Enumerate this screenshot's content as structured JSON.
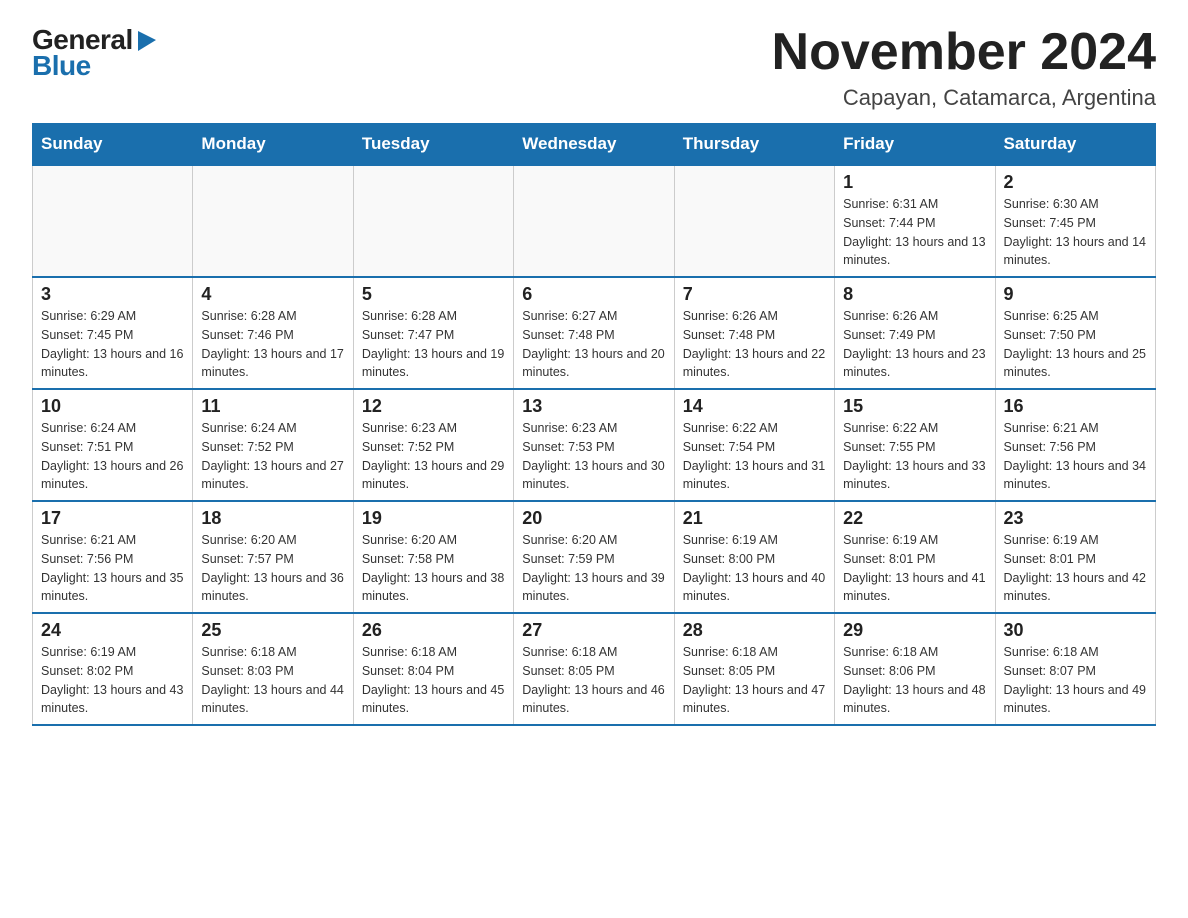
{
  "logo": {
    "general": "General",
    "blue": "Blue",
    "triangle": "▶"
  },
  "title": "November 2024",
  "location": "Capayan, Catamarca, Argentina",
  "days_of_week": [
    "Sunday",
    "Monday",
    "Tuesday",
    "Wednesday",
    "Thursday",
    "Friday",
    "Saturday"
  ],
  "weeks": [
    [
      {
        "day": "",
        "info": ""
      },
      {
        "day": "",
        "info": ""
      },
      {
        "day": "",
        "info": ""
      },
      {
        "day": "",
        "info": ""
      },
      {
        "day": "",
        "info": ""
      },
      {
        "day": "1",
        "info": "Sunrise: 6:31 AM\nSunset: 7:44 PM\nDaylight: 13 hours and 13 minutes."
      },
      {
        "day": "2",
        "info": "Sunrise: 6:30 AM\nSunset: 7:45 PM\nDaylight: 13 hours and 14 minutes."
      }
    ],
    [
      {
        "day": "3",
        "info": "Sunrise: 6:29 AM\nSunset: 7:45 PM\nDaylight: 13 hours and 16 minutes."
      },
      {
        "day": "4",
        "info": "Sunrise: 6:28 AM\nSunset: 7:46 PM\nDaylight: 13 hours and 17 minutes."
      },
      {
        "day": "5",
        "info": "Sunrise: 6:28 AM\nSunset: 7:47 PM\nDaylight: 13 hours and 19 minutes."
      },
      {
        "day": "6",
        "info": "Sunrise: 6:27 AM\nSunset: 7:48 PM\nDaylight: 13 hours and 20 minutes."
      },
      {
        "day": "7",
        "info": "Sunrise: 6:26 AM\nSunset: 7:48 PM\nDaylight: 13 hours and 22 minutes."
      },
      {
        "day": "8",
        "info": "Sunrise: 6:26 AM\nSunset: 7:49 PM\nDaylight: 13 hours and 23 minutes."
      },
      {
        "day": "9",
        "info": "Sunrise: 6:25 AM\nSunset: 7:50 PM\nDaylight: 13 hours and 25 minutes."
      }
    ],
    [
      {
        "day": "10",
        "info": "Sunrise: 6:24 AM\nSunset: 7:51 PM\nDaylight: 13 hours and 26 minutes."
      },
      {
        "day": "11",
        "info": "Sunrise: 6:24 AM\nSunset: 7:52 PM\nDaylight: 13 hours and 27 minutes."
      },
      {
        "day": "12",
        "info": "Sunrise: 6:23 AM\nSunset: 7:52 PM\nDaylight: 13 hours and 29 minutes."
      },
      {
        "day": "13",
        "info": "Sunrise: 6:23 AM\nSunset: 7:53 PM\nDaylight: 13 hours and 30 minutes."
      },
      {
        "day": "14",
        "info": "Sunrise: 6:22 AM\nSunset: 7:54 PM\nDaylight: 13 hours and 31 minutes."
      },
      {
        "day": "15",
        "info": "Sunrise: 6:22 AM\nSunset: 7:55 PM\nDaylight: 13 hours and 33 minutes."
      },
      {
        "day": "16",
        "info": "Sunrise: 6:21 AM\nSunset: 7:56 PM\nDaylight: 13 hours and 34 minutes."
      }
    ],
    [
      {
        "day": "17",
        "info": "Sunrise: 6:21 AM\nSunset: 7:56 PM\nDaylight: 13 hours and 35 minutes."
      },
      {
        "day": "18",
        "info": "Sunrise: 6:20 AM\nSunset: 7:57 PM\nDaylight: 13 hours and 36 minutes."
      },
      {
        "day": "19",
        "info": "Sunrise: 6:20 AM\nSunset: 7:58 PM\nDaylight: 13 hours and 38 minutes."
      },
      {
        "day": "20",
        "info": "Sunrise: 6:20 AM\nSunset: 7:59 PM\nDaylight: 13 hours and 39 minutes."
      },
      {
        "day": "21",
        "info": "Sunrise: 6:19 AM\nSunset: 8:00 PM\nDaylight: 13 hours and 40 minutes."
      },
      {
        "day": "22",
        "info": "Sunrise: 6:19 AM\nSunset: 8:01 PM\nDaylight: 13 hours and 41 minutes."
      },
      {
        "day": "23",
        "info": "Sunrise: 6:19 AM\nSunset: 8:01 PM\nDaylight: 13 hours and 42 minutes."
      }
    ],
    [
      {
        "day": "24",
        "info": "Sunrise: 6:19 AM\nSunset: 8:02 PM\nDaylight: 13 hours and 43 minutes."
      },
      {
        "day": "25",
        "info": "Sunrise: 6:18 AM\nSunset: 8:03 PM\nDaylight: 13 hours and 44 minutes."
      },
      {
        "day": "26",
        "info": "Sunrise: 6:18 AM\nSunset: 8:04 PM\nDaylight: 13 hours and 45 minutes."
      },
      {
        "day": "27",
        "info": "Sunrise: 6:18 AM\nSunset: 8:05 PM\nDaylight: 13 hours and 46 minutes."
      },
      {
        "day": "28",
        "info": "Sunrise: 6:18 AM\nSunset: 8:05 PM\nDaylight: 13 hours and 47 minutes."
      },
      {
        "day": "29",
        "info": "Sunrise: 6:18 AM\nSunset: 8:06 PM\nDaylight: 13 hours and 48 minutes."
      },
      {
        "day": "30",
        "info": "Sunrise: 6:18 AM\nSunset: 8:07 PM\nDaylight: 13 hours and 49 minutes."
      }
    ]
  ]
}
